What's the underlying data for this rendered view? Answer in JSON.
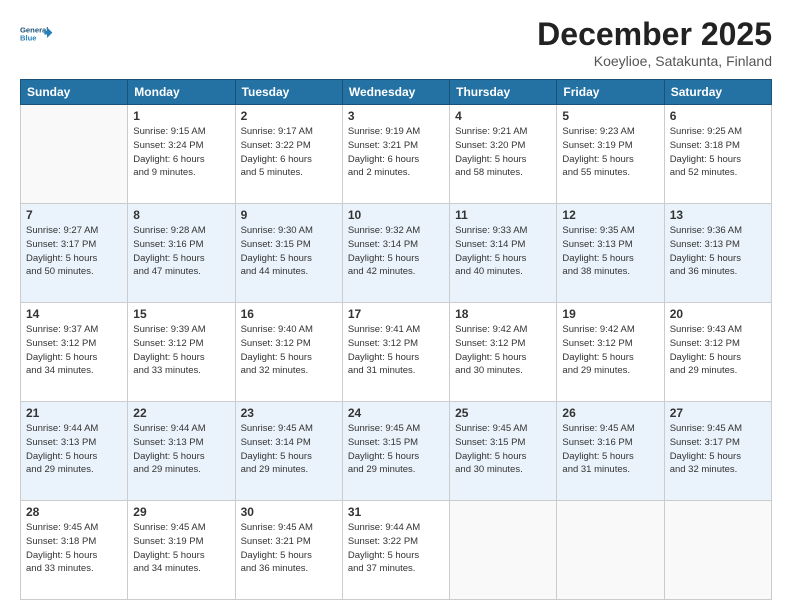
{
  "header": {
    "logo_line1": "General",
    "logo_line2": "Blue",
    "month": "December 2025",
    "location": "Koeylioe, Satakunta, Finland"
  },
  "days_of_week": [
    "Sunday",
    "Monday",
    "Tuesday",
    "Wednesday",
    "Thursday",
    "Friday",
    "Saturday"
  ],
  "weeks": [
    [
      {
        "day": "",
        "info": ""
      },
      {
        "day": "1",
        "info": "Sunrise: 9:15 AM\nSunset: 3:24 PM\nDaylight: 6 hours\nand 9 minutes."
      },
      {
        "day": "2",
        "info": "Sunrise: 9:17 AM\nSunset: 3:22 PM\nDaylight: 6 hours\nand 5 minutes."
      },
      {
        "day": "3",
        "info": "Sunrise: 9:19 AM\nSunset: 3:21 PM\nDaylight: 6 hours\nand 2 minutes."
      },
      {
        "day": "4",
        "info": "Sunrise: 9:21 AM\nSunset: 3:20 PM\nDaylight: 5 hours\nand 58 minutes."
      },
      {
        "day": "5",
        "info": "Sunrise: 9:23 AM\nSunset: 3:19 PM\nDaylight: 5 hours\nand 55 minutes."
      },
      {
        "day": "6",
        "info": "Sunrise: 9:25 AM\nSunset: 3:18 PM\nDaylight: 5 hours\nand 52 minutes."
      }
    ],
    [
      {
        "day": "7",
        "info": "Sunrise: 9:27 AM\nSunset: 3:17 PM\nDaylight: 5 hours\nand 50 minutes."
      },
      {
        "day": "8",
        "info": "Sunrise: 9:28 AM\nSunset: 3:16 PM\nDaylight: 5 hours\nand 47 minutes."
      },
      {
        "day": "9",
        "info": "Sunrise: 9:30 AM\nSunset: 3:15 PM\nDaylight: 5 hours\nand 44 minutes."
      },
      {
        "day": "10",
        "info": "Sunrise: 9:32 AM\nSunset: 3:14 PM\nDaylight: 5 hours\nand 42 minutes."
      },
      {
        "day": "11",
        "info": "Sunrise: 9:33 AM\nSunset: 3:14 PM\nDaylight: 5 hours\nand 40 minutes."
      },
      {
        "day": "12",
        "info": "Sunrise: 9:35 AM\nSunset: 3:13 PM\nDaylight: 5 hours\nand 38 minutes."
      },
      {
        "day": "13",
        "info": "Sunrise: 9:36 AM\nSunset: 3:13 PM\nDaylight: 5 hours\nand 36 minutes."
      }
    ],
    [
      {
        "day": "14",
        "info": "Sunrise: 9:37 AM\nSunset: 3:12 PM\nDaylight: 5 hours\nand 34 minutes."
      },
      {
        "day": "15",
        "info": "Sunrise: 9:39 AM\nSunset: 3:12 PM\nDaylight: 5 hours\nand 33 minutes."
      },
      {
        "day": "16",
        "info": "Sunrise: 9:40 AM\nSunset: 3:12 PM\nDaylight: 5 hours\nand 32 minutes."
      },
      {
        "day": "17",
        "info": "Sunrise: 9:41 AM\nSunset: 3:12 PM\nDaylight: 5 hours\nand 31 minutes."
      },
      {
        "day": "18",
        "info": "Sunrise: 9:42 AM\nSunset: 3:12 PM\nDaylight: 5 hours\nand 30 minutes."
      },
      {
        "day": "19",
        "info": "Sunrise: 9:42 AM\nSunset: 3:12 PM\nDaylight: 5 hours\nand 29 minutes."
      },
      {
        "day": "20",
        "info": "Sunrise: 9:43 AM\nSunset: 3:12 PM\nDaylight: 5 hours\nand 29 minutes."
      }
    ],
    [
      {
        "day": "21",
        "info": "Sunrise: 9:44 AM\nSunset: 3:13 PM\nDaylight: 5 hours\nand 29 minutes."
      },
      {
        "day": "22",
        "info": "Sunrise: 9:44 AM\nSunset: 3:13 PM\nDaylight: 5 hours\nand 29 minutes."
      },
      {
        "day": "23",
        "info": "Sunrise: 9:45 AM\nSunset: 3:14 PM\nDaylight: 5 hours\nand 29 minutes."
      },
      {
        "day": "24",
        "info": "Sunrise: 9:45 AM\nSunset: 3:15 PM\nDaylight: 5 hours\nand 29 minutes."
      },
      {
        "day": "25",
        "info": "Sunrise: 9:45 AM\nSunset: 3:15 PM\nDaylight: 5 hours\nand 30 minutes."
      },
      {
        "day": "26",
        "info": "Sunrise: 9:45 AM\nSunset: 3:16 PM\nDaylight: 5 hours\nand 31 minutes."
      },
      {
        "day": "27",
        "info": "Sunrise: 9:45 AM\nSunset: 3:17 PM\nDaylight: 5 hours\nand 32 minutes."
      }
    ],
    [
      {
        "day": "28",
        "info": "Sunrise: 9:45 AM\nSunset: 3:18 PM\nDaylight: 5 hours\nand 33 minutes."
      },
      {
        "day": "29",
        "info": "Sunrise: 9:45 AM\nSunset: 3:19 PM\nDaylight: 5 hours\nand 34 minutes."
      },
      {
        "day": "30",
        "info": "Sunrise: 9:45 AM\nSunset: 3:21 PM\nDaylight: 5 hours\nand 36 minutes."
      },
      {
        "day": "31",
        "info": "Sunrise: 9:44 AM\nSunset: 3:22 PM\nDaylight: 5 hours\nand 37 minutes."
      },
      {
        "day": "",
        "info": ""
      },
      {
        "day": "",
        "info": ""
      },
      {
        "day": "",
        "info": ""
      }
    ]
  ]
}
